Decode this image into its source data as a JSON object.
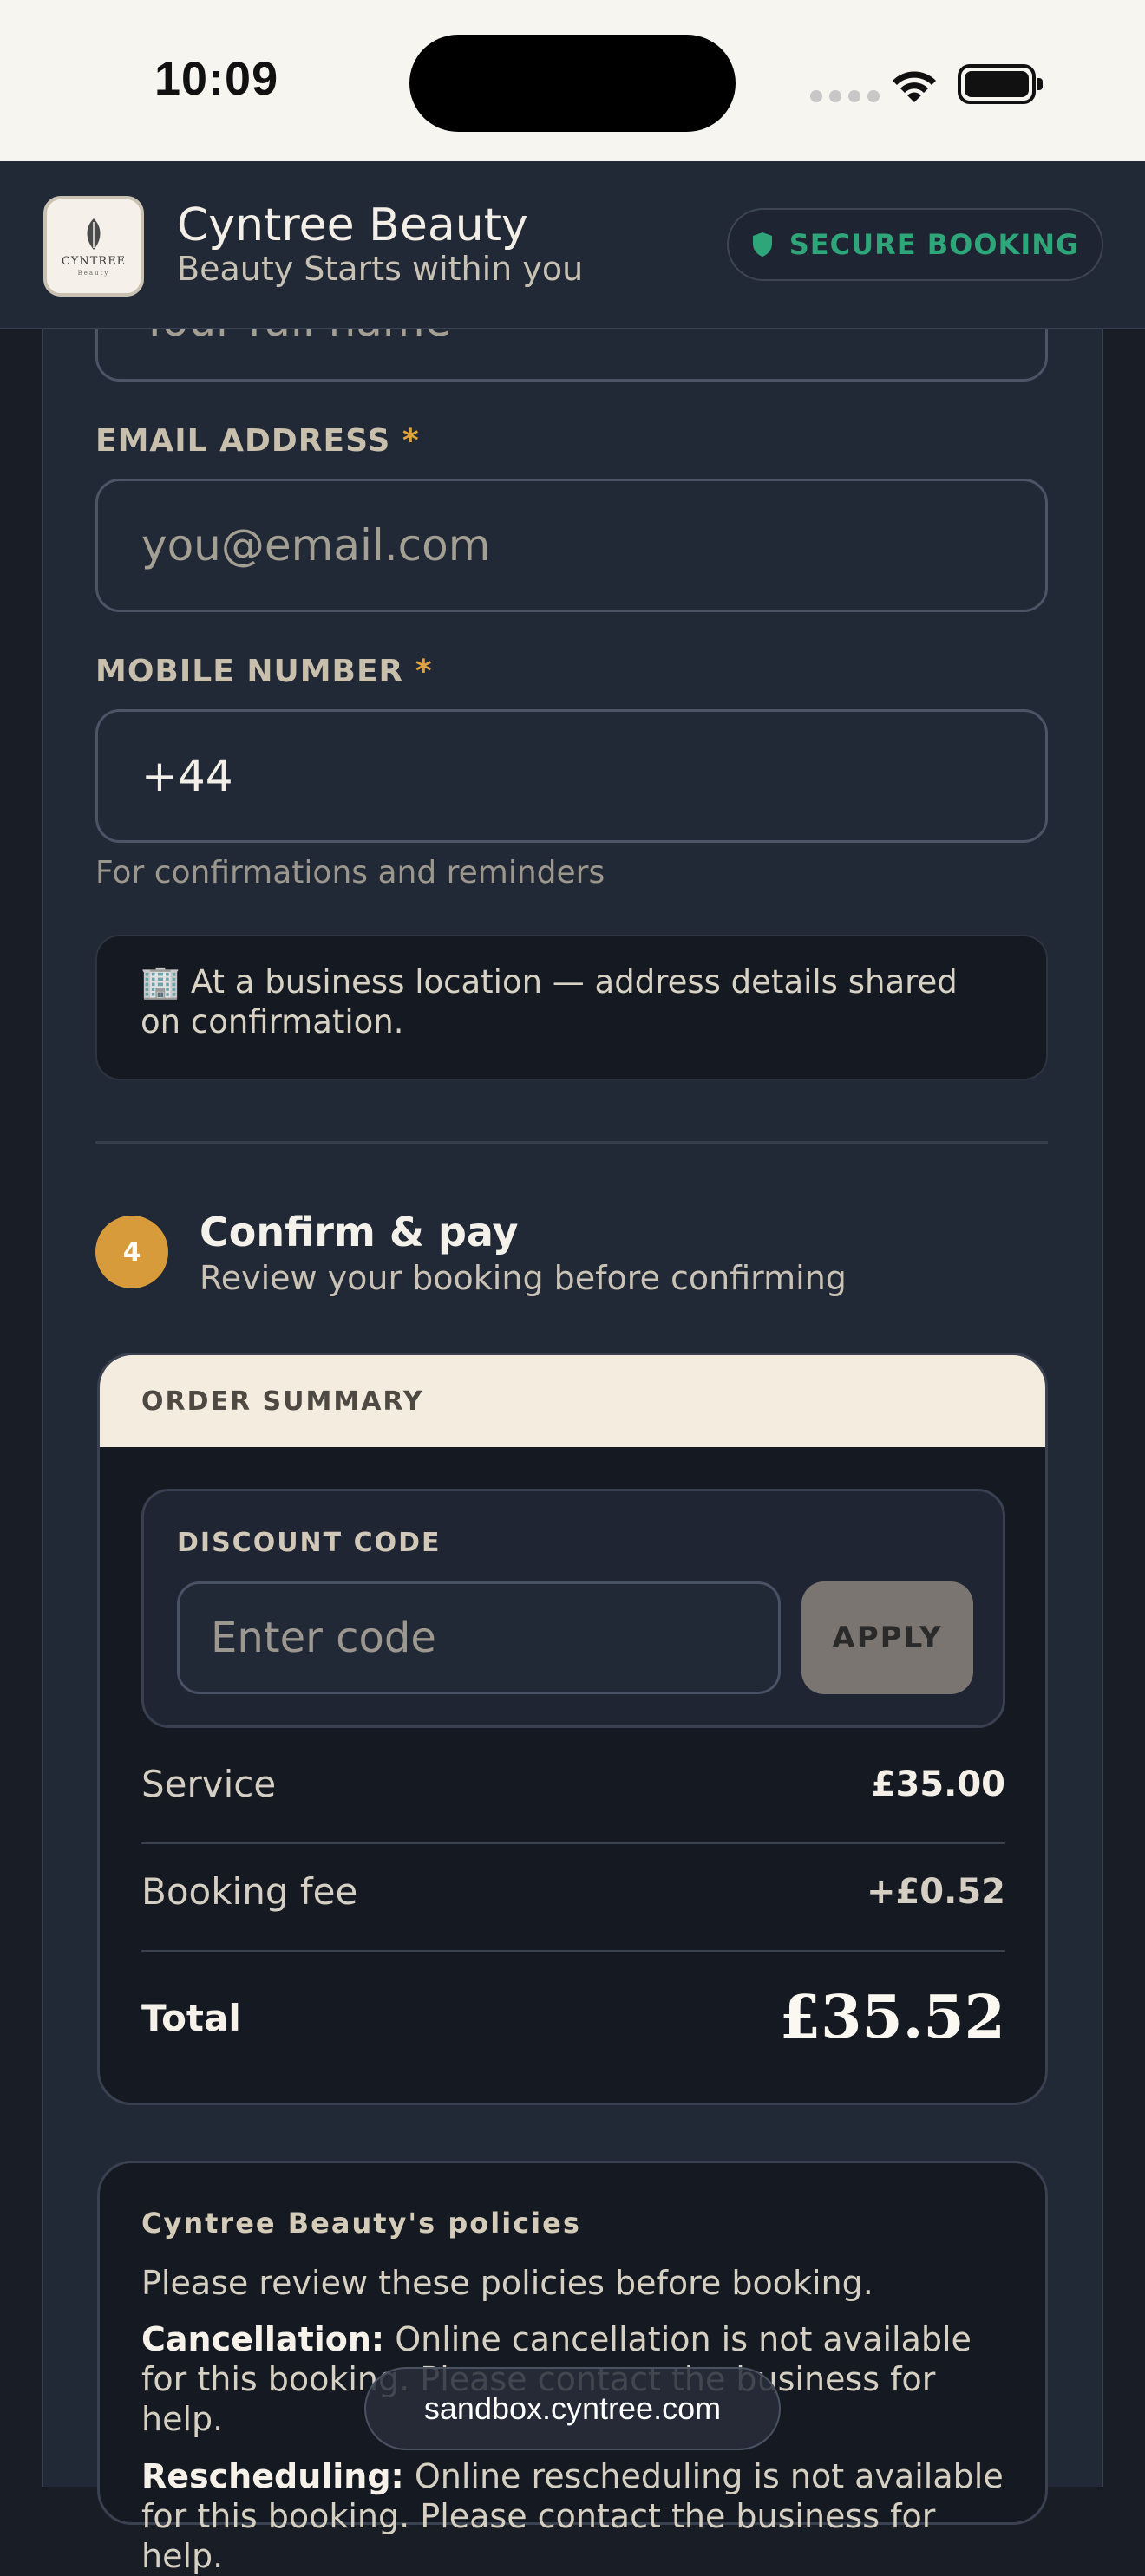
{
  "status_bar": {
    "time": "10:09"
  },
  "header": {
    "logo_text": "CYNTREE",
    "logo_sub": "Beauty",
    "brand_name": "Cyntree Beauty",
    "tagline": "Beauty Starts within you",
    "secure_badge": "SECURE BOOKING"
  },
  "form": {
    "name_placeholder": "Your full name",
    "email": {
      "label": "EMAIL ADDRESS",
      "required_mark": "*",
      "placeholder": "you@email.com"
    },
    "mobile": {
      "label": "MOBILE NUMBER",
      "required_mark": "*",
      "value": "+44",
      "hint": "For confirmations and reminders"
    },
    "location_note": "At a business location — address details shared on confirmation."
  },
  "step": {
    "number": "4",
    "title": "Confirm & pay",
    "subtitle": "Review your booking before confirming"
  },
  "order_summary": {
    "heading": "ORDER SUMMARY",
    "discount": {
      "label": "DISCOUNT CODE",
      "placeholder": "Enter code",
      "apply_label": "APPLY"
    },
    "service_label": "Service",
    "service_value": "£35.00",
    "fee_label": "Booking fee",
    "fee_value": "+£0.52",
    "total_label": "Total",
    "total_value": "£35.52"
  },
  "policies": {
    "title": "Cyntree Beauty's policies",
    "intro": "Please review these policies before booking.",
    "cancellation_label": "Cancellation:",
    "cancellation_text": "Online cancellation is not available for this booking. Please contact the business for help.",
    "rescheduling_label": "Rescheduling:",
    "rescheduling_text": "Online rescheduling is not available for this booking. Please contact the business for help."
  },
  "browser": {
    "url": "sandbox.cyntree.com"
  },
  "colors": {
    "background": "#212836",
    "accent_gold": "#d89b3b",
    "secure_green": "#2fa57a",
    "summary_header": "#f3ecdf"
  }
}
